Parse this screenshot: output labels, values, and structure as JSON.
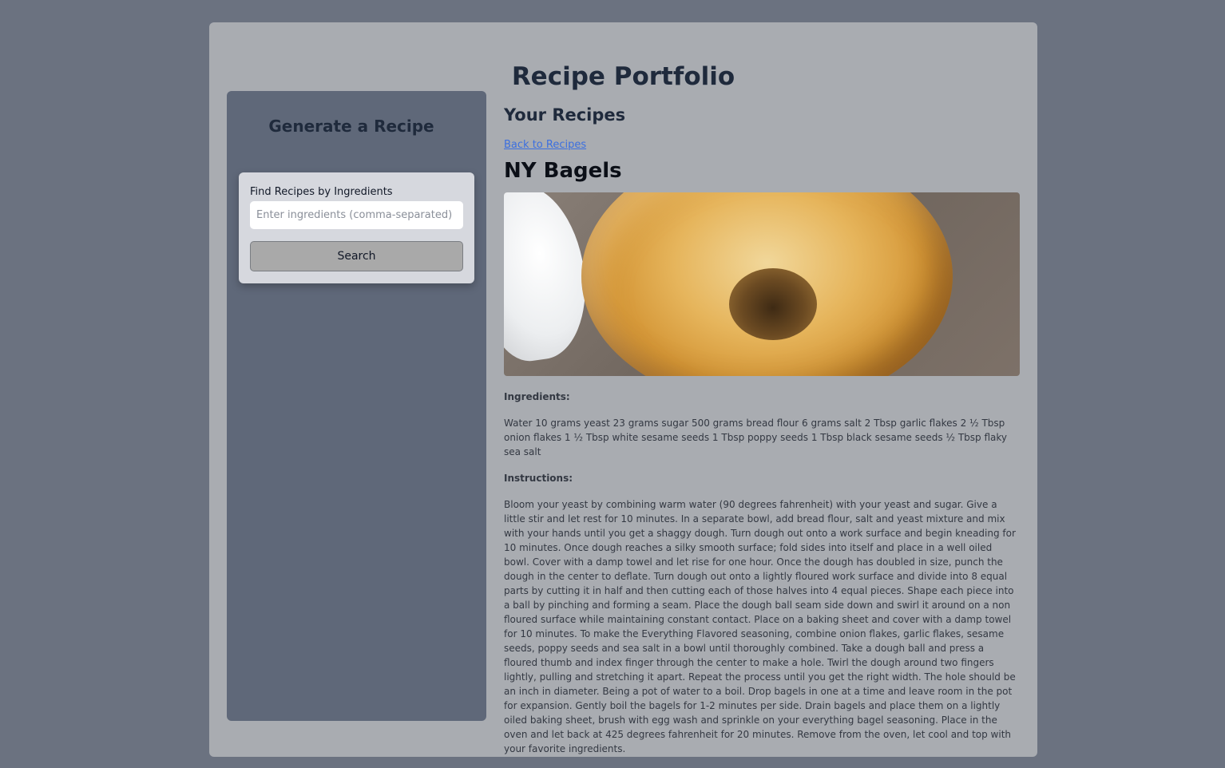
{
  "app": {
    "title": "Recipe Portfolio"
  },
  "sidebar": {
    "title": "Generate a Recipe",
    "search": {
      "label": "Find Recipes by Ingredients",
      "placeholder": "Enter ingredients (comma-separated)",
      "value": "",
      "button_label": "Search"
    }
  },
  "main": {
    "section_title": "Your Recipes",
    "back_link": "Back to Recipes",
    "recipe": {
      "title": "NY Bagels",
      "image_icon": "bagel-photo",
      "ingredients_label": "Ingredients:",
      "ingredients": "Water 10 grams yeast 23 grams sugar 500 grams bread flour 6 grams salt 2 Tbsp garlic flakes 2 ½ Tbsp onion flakes 1 ½ Tbsp white sesame seeds 1 Tbsp poppy seeds 1 Tbsp black sesame seeds ½ Tbsp flaky sea salt",
      "instructions_label": "Instructions:",
      "instructions": "Bloom your yeast by combining warm water (90 degrees fahrenheit) with your yeast and sugar. Give a little stir and let rest for 10 minutes. In a separate bowl, add bread flour, salt and yeast mixture and mix with your hands until you get a shaggy dough. Turn dough out onto a work surface and begin kneading for 10 minutes. Once dough reaches a silky smooth surface; fold sides into itself and place in a well oiled bowl. Cover with a damp towel and let rise for one hour. Once the dough has doubled in size, punch the dough in the center to deflate. Turn dough out onto a lightly floured work surface and divide into 8 equal parts by cutting it in half and then cutting each of those halves into 4 equal pieces. Shape each piece into a ball by pinching and forming a seam. Place the dough ball seam side down and swirl it around on a non floured surface while maintaining constant contact. Place on a baking sheet and cover with a damp towel for 10 minutes. To make the Everything Flavored seasoning, combine onion flakes, garlic flakes, sesame seeds, poppy seeds and sea salt in a bowl until thoroughly combined. Take a dough ball and press a floured thumb and index finger through the center to make a hole. Twirl the dough around two fingers lightly, pulling and stretching it apart. Repeat the process until you get the right width. The hole should be an inch in diameter. Being a pot of water to a boil. Drop bagels in one at a time and leave room in the pot for expansion. Gently boil the bagels for 1-2 minutes per side. Drain bagels and place them on a lightly oiled baking sheet, brush with egg wash and sprinkle on your everything bagel seasoning. Place in the oven and let back at 425 degrees fahrenheit for 20 minutes. Remove from the oven, let cool and top with your favorite ingredients."
    }
  },
  "colors": {
    "page_background": "#6b7280",
    "card_background": "#a9acb1",
    "sidebar_background": "#5f6879",
    "heading": "#1f2a3c",
    "link": "#3b6fe0"
  }
}
